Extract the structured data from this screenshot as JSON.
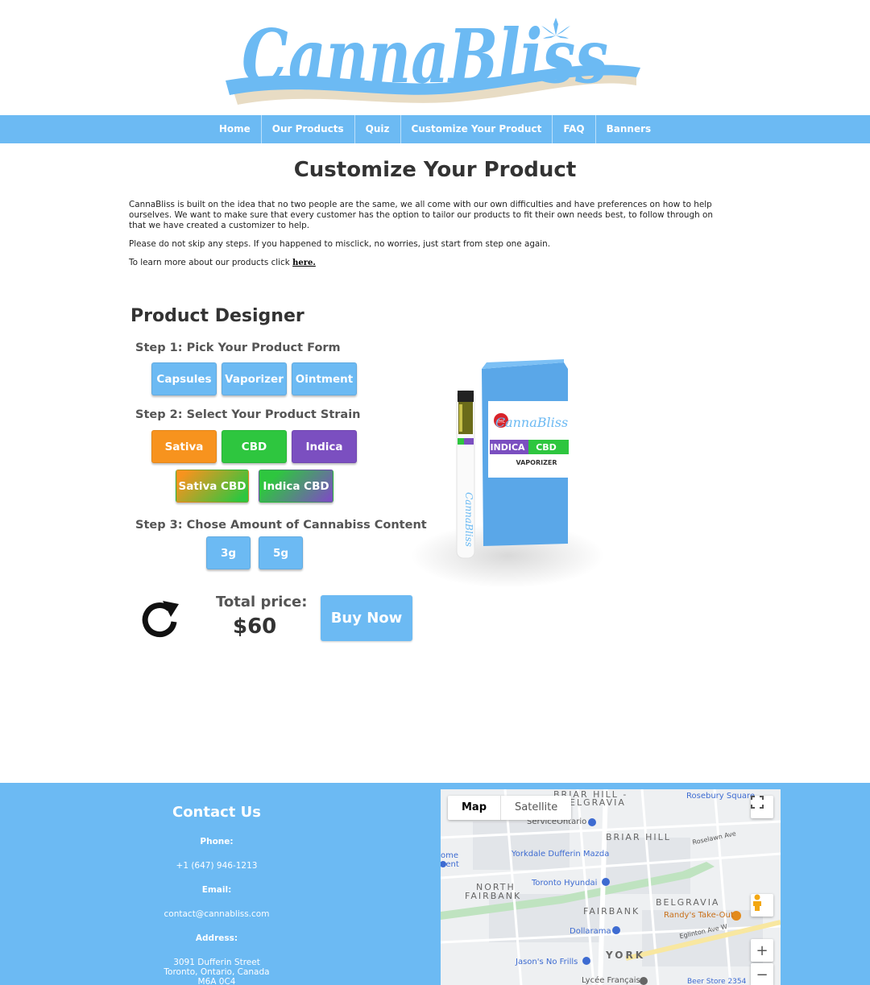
{
  "brand": {
    "logo_text": "CannaBliss"
  },
  "nav": {
    "items": [
      {
        "label": "Home"
      },
      {
        "label": "Our Products"
      },
      {
        "label": "Quiz"
      },
      {
        "label": "Customize Your Product"
      },
      {
        "label": "FAQ"
      },
      {
        "label": "Banners"
      }
    ]
  },
  "intro": {
    "title": "Customize Your Product",
    "paragraph1": "CannaBliss is built on the idea that no two people are the same, we all come with our own difficulties and have preferences on how to help ourselves. We want to make sure that every customer has the option to tailor our products to fit their own needs best, to follow through on that we have created a customizer to help.",
    "paragraph2": "Please do not skip any steps. If you happened to misclick, no worries, just start from step one again.",
    "paragraph3_prefix": "To learn more about our products click ",
    "paragraph3_link": "here."
  },
  "designer": {
    "title": "Product Designer",
    "step1": {
      "label": "Step 1: Pick Your Product Form",
      "options": [
        "Capsules",
        "Vaporizer",
        "Ointment"
      ]
    },
    "step2": {
      "label": "Step 2: Select Your Product Strain",
      "options": [
        "Sativa",
        "CBD",
        "Indica",
        "Sativa CBD",
        "Indica CBD"
      ]
    },
    "step3": {
      "label": "Step 3: Chose Amount of Cannabiss Content",
      "options": [
        "3g",
        "5g"
      ]
    },
    "total_label": "Total price:",
    "total_value": "$60",
    "buy_label": "Buy Now",
    "product_box": {
      "brand": "CannaBliss",
      "strain_left": "INDICA",
      "strain_right": "CBD",
      "form": "VAPORIZER",
      "badge": "THC"
    }
  },
  "colors": {
    "accent": "#6cbaf3",
    "sativa": "#f7931e",
    "cbd": "#2ec63f",
    "indica": "#7b4fc0"
  },
  "footer": {
    "title": "Contact Us",
    "phone_label": "Phone:",
    "phone": "+1 (647) 946-1213",
    "email_label": "Email:",
    "email": "contact@cannabliss.com",
    "address_label": "Address:",
    "address_line1": "3091 Dufferin Street",
    "address_line2": "Toronto, Ontario, Canada",
    "address_line3": "M6A 0C4"
  },
  "map": {
    "tab_map": "Map",
    "tab_satellite": "Satellite",
    "labels": {
      "briar_hill_top": "BRIAR HILL -",
      "belgravia_top": "ELGRAVIA",
      "rosebury": "Rosebury Square",
      "serviceontario": "ServiceOntario",
      "briar_hill": "BRIAR HILL",
      "roselawn": "Roselawn Ave",
      "home": "ome",
      "ment": "nent",
      "yorkdale": "Yorkdale Dufferin Mazda",
      "north": "NORTH",
      "fairbank_n": "FAIRBANK",
      "toronto_hyundai": "Toronto Hyundai",
      "belgravia": "BELGRAVIA",
      "fairbank": "FAIRBANK",
      "randys": "Randy's Take-Out",
      "dollarama": "Dollarama",
      "eglinton": "Eglinton Ave W",
      "york": "YORK",
      "jasons": "Jason's No Frills",
      "lycee": "Lycée Français",
      "beer_store": "Beer Store 2354"
    },
    "zoom_in": "+",
    "zoom_out": "−",
    "icons": [
      "fullscreen-icon",
      "pegman-icon"
    ]
  },
  "icons": {
    "refresh": "refresh-icon"
  }
}
